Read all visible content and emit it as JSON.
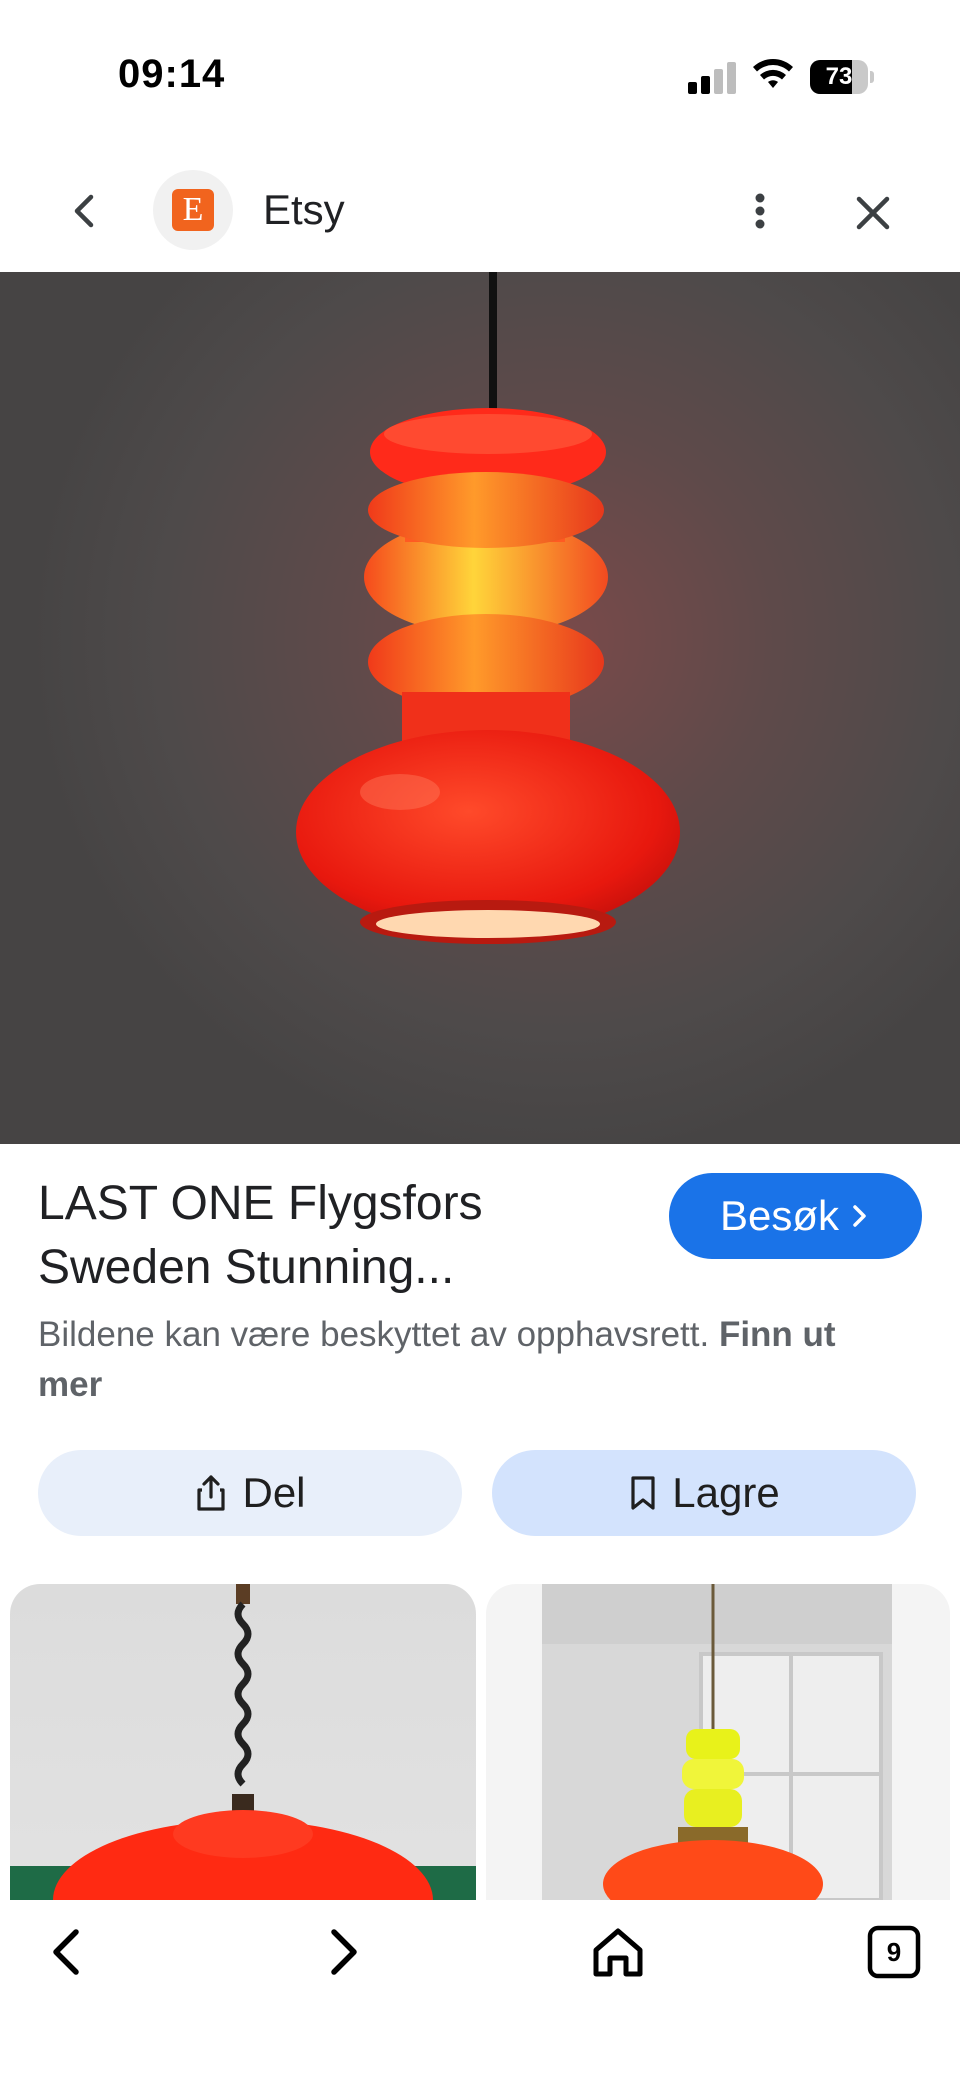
{
  "status_bar": {
    "time": "09:14",
    "battery_level": "73",
    "battery_fraction": 0.73,
    "icons": [
      "cellular-signal-icon",
      "wifi-icon",
      "battery-icon"
    ]
  },
  "header": {
    "site_name": "Etsy",
    "logo_letter": "E",
    "icons": [
      "back-arrow-icon",
      "more-vertical-icon",
      "close-icon"
    ]
  },
  "result": {
    "title_line1": "LAST ONE Flygsfors",
    "title_line2": "Sweden Stunning...",
    "visit_label": "Besøk",
    "copyright_text": "Bildene kan være beskyttet av opphavsrett. ",
    "learn_more": "Finn ut mer"
  },
  "actions": {
    "share_label": "Del",
    "save_label": "Lagre"
  },
  "bottom_nav": {
    "tabs_count": "9",
    "icons": [
      "back-icon",
      "forward-icon",
      "home-icon",
      "tabs-icon"
    ]
  },
  "colors": {
    "accent": "#1a73e8",
    "etsy_orange": "#f1641e",
    "share_bg": "#e8effa",
    "save_bg": "#d3e3fd"
  }
}
